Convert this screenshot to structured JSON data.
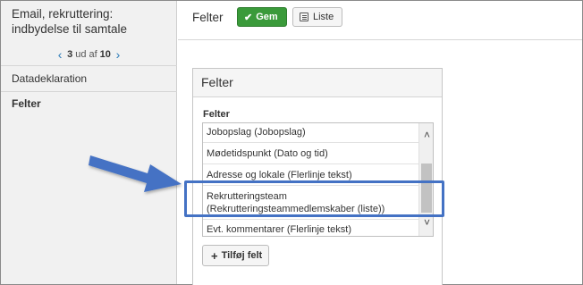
{
  "sidebar": {
    "title": "Email, rekruttering: indbydelse til samtale",
    "pager": {
      "current": "3",
      "of_label": "ud af",
      "total": "10",
      "prev_icon": "chevron-left-icon",
      "next_icon": "chevron-right-icon"
    },
    "items": [
      {
        "label": "Datadeklaration"
      },
      {
        "label": "Felter",
        "active": true
      }
    ]
  },
  "topbar": {
    "title": "Felter",
    "save_label": "Gem",
    "save_icon": "checkmark-icon",
    "list_label": "Liste",
    "list_icon": "list-icon",
    "save_color": "#3a9a3a"
  },
  "panel": {
    "title": "Felter",
    "field_label": "Felter",
    "list_items": [
      "Jobopslag (Jobopslag)",
      "Mødetidspunkt (Dato og tid)",
      "Adresse og lokale (Flerlinje tekst)",
      "Rekrutteringsteam (Rekrutteringsteammedlemskaber (liste))",
      "Evt. kommentarer (Flerlinje tekst)"
    ],
    "add_label": "Tilføj felt",
    "add_icon": "plus-icon"
  },
  "annotation": {
    "color": "#4472c4",
    "highlighted_item": "Rekrutteringsteam (Rekrutteringsteammedlemskaber (liste))"
  }
}
